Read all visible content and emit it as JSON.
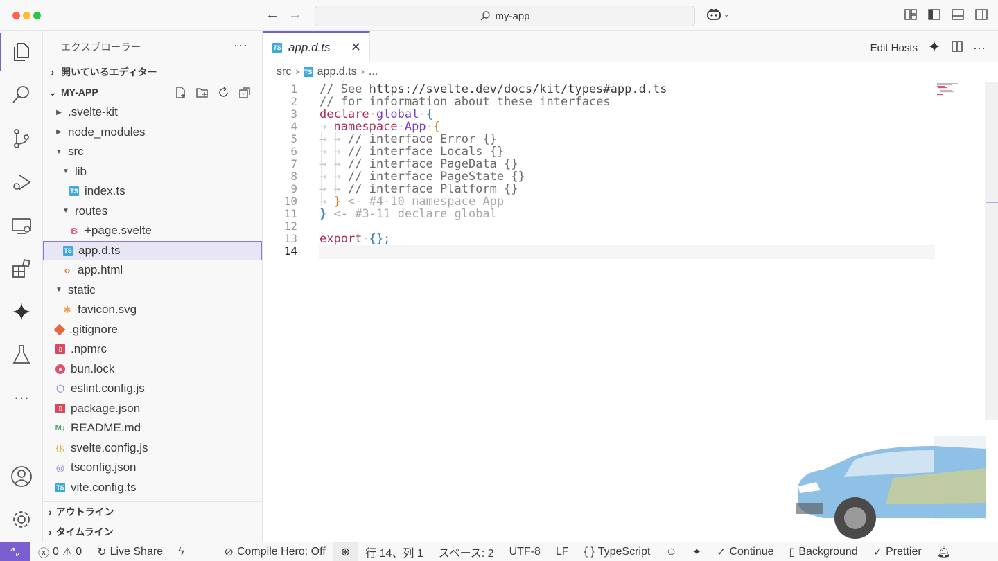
{
  "window": {
    "search_text": "my-app"
  },
  "activity_bar": {
    "items": [
      "explorer",
      "search",
      "source-control",
      "run-debug",
      "remote-explorer",
      "extensions",
      "copilot",
      "testing",
      "more"
    ],
    "bottom": [
      "accounts",
      "manage"
    ]
  },
  "sidebar": {
    "title": "エクスプローラー",
    "more": "···",
    "open_editors": "開いているエディター",
    "project": "MY-APP",
    "tree": [
      {
        "label": ".svelte-kit",
        "type": "folder",
        "depth": 1,
        "expanded": false
      },
      {
        "label": "node_modules",
        "type": "folder",
        "depth": 1,
        "expanded": false
      },
      {
        "label": "src",
        "type": "folder",
        "depth": 1,
        "expanded": true
      },
      {
        "label": "lib",
        "type": "folder",
        "depth": 2,
        "expanded": true
      },
      {
        "label": "index.ts",
        "type": "ts",
        "depth": 3
      },
      {
        "label": "routes",
        "type": "folder",
        "depth": 2,
        "expanded": true
      },
      {
        "label": "+page.svelte",
        "type": "svelte",
        "depth": 3
      },
      {
        "label": "app.d.ts",
        "type": "ts",
        "depth": 2,
        "selected": true
      },
      {
        "label": "app.html",
        "type": "html",
        "depth": 2
      },
      {
        "label": "static",
        "type": "folder",
        "depth": 1,
        "expanded": true
      },
      {
        "label": "favicon.svg",
        "type": "svg",
        "depth": 2
      },
      {
        "label": ".gitignore",
        "type": "git",
        "depth": 1
      },
      {
        "label": ".npmrc",
        "type": "npm",
        "depth": 1
      },
      {
        "label": "bun.lock",
        "type": "bun",
        "depth": 1
      },
      {
        "label": "eslint.config.js",
        "type": "eslint",
        "depth": 1
      },
      {
        "label": "package.json",
        "type": "npm",
        "depth": 1
      },
      {
        "label": "README.md",
        "type": "md",
        "depth": 1
      },
      {
        "label": "svelte.config.js",
        "type": "js",
        "depth": 1
      },
      {
        "label": "tsconfig.json",
        "type": "tscfg",
        "depth": 1
      },
      {
        "label": "vite.config.ts",
        "type": "ts",
        "depth": 1
      }
    ],
    "outline": "アウトライン",
    "timeline": "タイムライン"
  },
  "editor": {
    "tab_label": "app.d.ts",
    "edit_hosts": "Edit Hosts",
    "breadcrumb": {
      "folder": "src",
      "file": "app.d.ts",
      "more": "..."
    },
    "line_numbers": [
      "1",
      "2",
      "3",
      "4",
      "5",
      "6",
      "7",
      "8",
      "9",
      "10",
      "11",
      "12",
      "13",
      "14"
    ],
    "code": {
      "l1_comment": "// See ",
      "l1_link": "https://svelte.dev/docs/kit/types#app.d.ts",
      "l2": "// for information about these interfaces",
      "l3_kw": "declare",
      "l3_kw2": "global",
      "l4_kw": "namespace",
      "l4_name": "App",
      "l5": "// interface Error {}",
      "l6": "// interface Locals {}",
      "l7": "// interface PageData {}",
      "l8": "// interface PageState {}",
      "l9": "// interface Platform {}",
      "l10_ghost": "<- #4-10 namespace App",
      "l11_ghost": "<- #3-11 declare global",
      "l13_kw": "export",
      "l13_rest": "{};"
    }
  },
  "statusbar": {
    "errors": "0",
    "warnings": "0",
    "live_share": "Live Share",
    "compile_hero": "Compile Hero: Off",
    "position": "行 14、列 1",
    "spaces": "スペース: 2",
    "encoding": "UTF-8",
    "eol": "LF",
    "language": "TypeScript",
    "continue": "Continue",
    "background": "Background",
    "prettier": "Prettier"
  }
}
